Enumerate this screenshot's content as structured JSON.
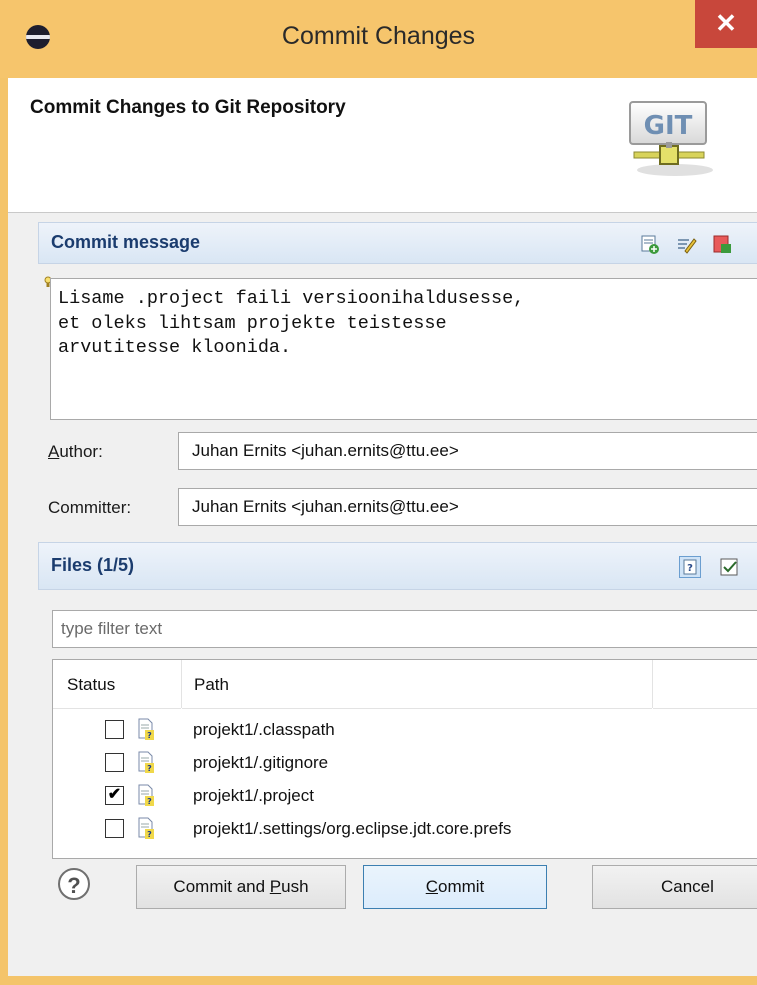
{
  "window": {
    "title": "Commit Changes",
    "close_glyph": "✕"
  },
  "header": {
    "dialog_title": "Commit Changes to Git Repository",
    "logo_text": "GIT"
  },
  "commit_message": {
    "section_title": "Commit message",
    "text": "Lisame .project faili versioonihaldusesse,\net oleks lihtsam projekte teistesse\narvutitesse kloonida.",
    "toolbar_icons": [
      "previous-messages-icon",
      "signed-off-by-icon",
      "change-id-icon"
    ]
  },
  "author": {
    "label_mnemonic": "A",
    "label_rest": "uthor:",
    "value": "Juhan Ernits <juhan.ernits@ttu.ee>"
  },
  "committer": {
    "label": "Committer:",
    "value": "Juhan Ernits <juhan.ernits@ttu.ee>"
  },
  "files": {
    "section_title": "Files (1/5)",
    "filter_placeholder": "type filter text",
    "columns": [
      "Status",
      "Path"
    ],
    "rows": [
      {
        "path": "projekt1/.classpath",
        "checked": false
      },
      {
        "path": "projekt1/.gitignore",
        "checked": false
      },
      {
        "path": "projekt1/.project",
        "checked": true
      },
      {
        "path": "projekt1/.settings/org.eclipse.jdt.core.prefs",
        "checked": false
      }
    ],
    "toolbar_icons": [
      "show-untracked-icon",
      "select-all-icon"
    ]
  },
  "buttons": {
    "help_glyph": "?",
    "commit_push": {
      "before": "Commit and ",
      "mnemonic": "P",
      "after": "ush"
    },
    "commit": {
      "before": "",
      "mnemonic": "C",
      "after": "ommit"
    },
    "cancel": "Cancel"
  },
  "colors": {
    "title_bar": "#f6c56c",
    "close_button": "#c8473b",
    "section_title": "#1b3c6e"
  }
}
